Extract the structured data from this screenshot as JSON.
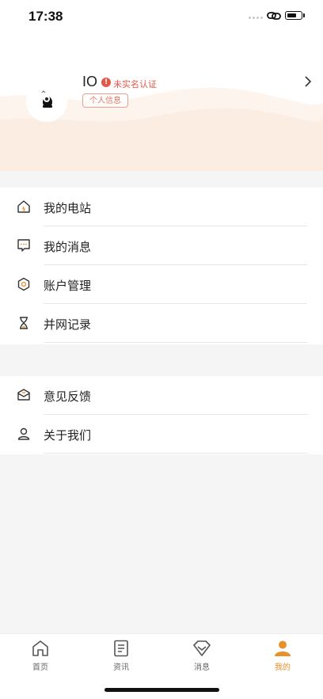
{
  "status_bar": {
    "time": "17:38"
  },
  "profile": {
    "name": "IO",
    "verify_icon": "!",
    "verify_text": "未实名认证",
    "info_button": "个人信息"
  },
  "menu_group_1": [
    {
      "label": "我的电站",
      "icon": "home-outline-icon"
    },
    {
      "label": "我的消息",
      "icon": "message-bubble-icon"
    },
    {
      "label": "账户管理",
      "icon": "settings-hexagon-icon"
    },
    {
      "label": "并网记录",
      "icon": "hourglass-icon"
    }
  ],
  "menu_group_2": [
    {
      "label": "意见反馈",
      "icon": "envelope-icon"
    },
    {
      "label": "关于我们",
      "icon": "person-outline-icon"
    }
  ],
  "tab_bar": [
    {
      "label": "首页",
      "icon": "home-icon",
      "active": false
    },
    {
      "label": "资讯",
      "icon": "document-icon",
      "active": false
    },
    {
      "label": "消息",
      "icon": "diamond-mail-icon",
      "active": false
    },
    {
      "label": "我的",
      "icon": "person-icon",
      "active": true
    }
  ],
  "colors": {
    "accent": "#e8902a",
    "warning": "#e05a4a",
    "wave": "#fbeee4"
  }
}
